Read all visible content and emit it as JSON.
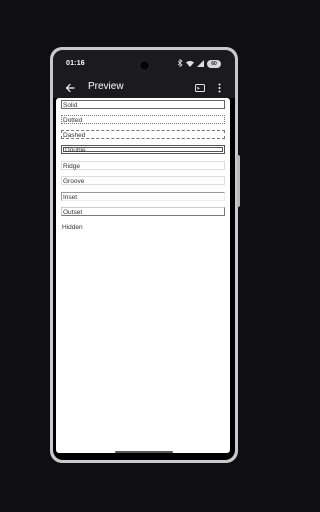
{
  "status_bar": {
    "time": "01:16",
    "battery": "60",
    "icons": [
      "bluetooth-icon",
      "wifi-icon",
      "signal-icon",
      "battery-icon"
    ]
  },
  "app_bar": {
    "title": "Preview",
    "actions": [
      "cast-icon",
      "more-vert-icon"
    ]
  },
  "border_rows": [
    {
      "label": "Solid"
    },
    {
      "label": "Dotted"
    },
    {
      "label": "Dashed"
    },
    {
      "label": "Double"
    },
    {
      "label": "Ridge"
    },
    {
      "label": "Groove"
    },
    {
      "label": "Inset"
    },
    {
      "label": "Outset"
    },
    {
      "label": "Hidden"
    }
  ],
  "colors": {
    "app_bar": "#1b1b1d",
    "background": "#0f0e12",
    "content": "#ffffff"
  }
}
